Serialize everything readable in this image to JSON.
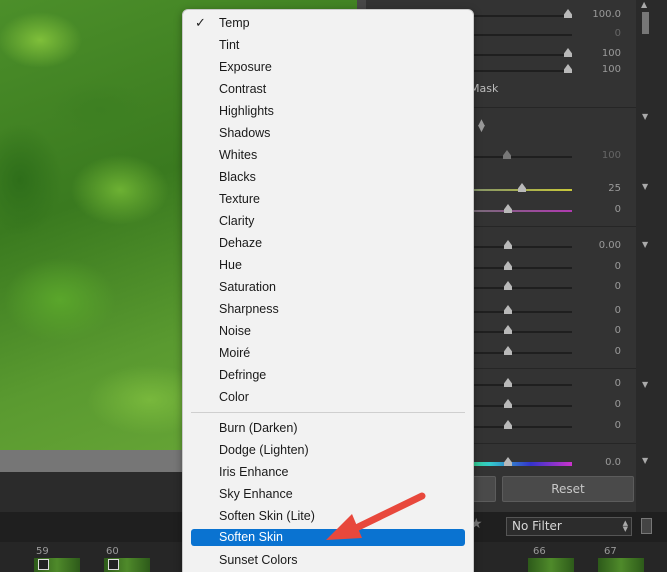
{
  "panel": {
    "sliders": [
      {
        "value": "100.0"
      },
      {
        "value": "0"
      },
      {
        "value": "100"
      },
      {
        "value": "100"
      },
      {
        "value": "100"
      },
      {
        "value": "25"
      },
      {
        "value": "0"
      },
      {
        "value": "0.00"
      },
      {
        "value": "0"
      },
      {
        "value": "0"
      },
      {
        "value": "0"
      },
      {
        "value": "0"
      },
      {
        "value": "0"
      },
      {
        "value": "0"
      },
      {
        "value": "0"
      },
      {
        "value": "0"
      },
      {
        "value": "0.0"
      }
    ],
    "mask_label": "Mask",
    "reset_label": "Reset"
  },
  "filmstrip": {
    "filter_value": "No Filter",
    "frames": [
      "59",
      "60",
      "66",
      "67"
    ]
  },
  "menu": {
    "checked_item": "Temp",
    "items": [
      "Temp",
      "Tint",
      "Exposure",
      "Contrast",
      "Highlights",
      "Shadows",
      "Whites",
      "Blacks",
      "Texture",
      "Clarity",
      "Dehaze",
      "Hue",
      "Saturation",
      "Sharpness",
      "Noise",
      "Moiré",
      "Defringe",
      "Color"
    ],
    "presets": [
      "Burn (Darken)",
      "Dodge (Lighten)",
      "Iris Enhance",
      "Sky Enhance",
      "Soften Skin (Lite)",
      "Soften Skin",
      "Sunset Colors"
    ],
    "selected_item": "Soften Skin"
  },
  "colors": {
    "selection": "#0a73d1",
    "annotation_arrow": "#e8483c"
  },
  "icons": {
    "check": "checkmark-icon",
    "star": "star-icon",
    "filter_arrows": "up-down-arrows-icon"
  }
}
